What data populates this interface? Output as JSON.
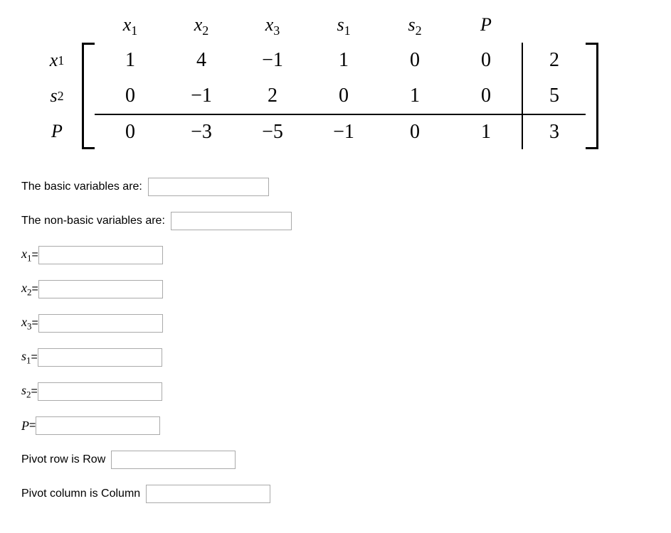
{
  "tableau": {
    "col_headers": [
      "x₁",
      "x₂",
      "x₃",
      "s₁",
      "s₂",
      "P"
    ],
    "row_labels": [
      "x₁",
      "s₂",
      "P"
    ],
    "rows": [
      {
        "cells": [
          "1",
          "4",
          "−1",
          "1",
          "0",
          "0"
        ],
        "rhs": "2"
      },
      {
        "cells": [
          "0",
          "−1",
          "2",
          "0",
          "1",
          "0"
        ],
        "rhs": "5"
      },
      {
        "cells": [
          "0",
          "−3",
          "−5",
          "−1",
          "0",
          "1"
        ],
        "rhs": "3"
      }
    ]
  },
  "form": {
    "basic_label": "The basic variables are:",
    "nonbasic_label": "The non-basic variables are:",
    "x1_label_prefix": "x",
    "x1_label_sub": "1",
    "x2_label_prefix": "x",
    "x2_label_sub": "2",
    "x3_label_prefix": "x",
    "x3_label_sub": "3",
    "s1_label_prefix": "s",
    "s1_label_sub": "1",
    "s2_label_prefix": "s",
    "s2_label_sub": "2",
    "p_label": "P",
    "equals": " = ",
    "pivot_row_label": "Pivot row is Row",
    "pivot_col_label": "Pivot column is Column",
    "basic_value": "",
    "nonbasic_value": "",
    "x1_value": "",
    "x2_value": "",
    "x3_value": "",
    "s1_value": "",
    "s2_value": "",
    "p_value": "",
    "pivot_row_value": "",
    "pivot_col_value": ""
  }
}
